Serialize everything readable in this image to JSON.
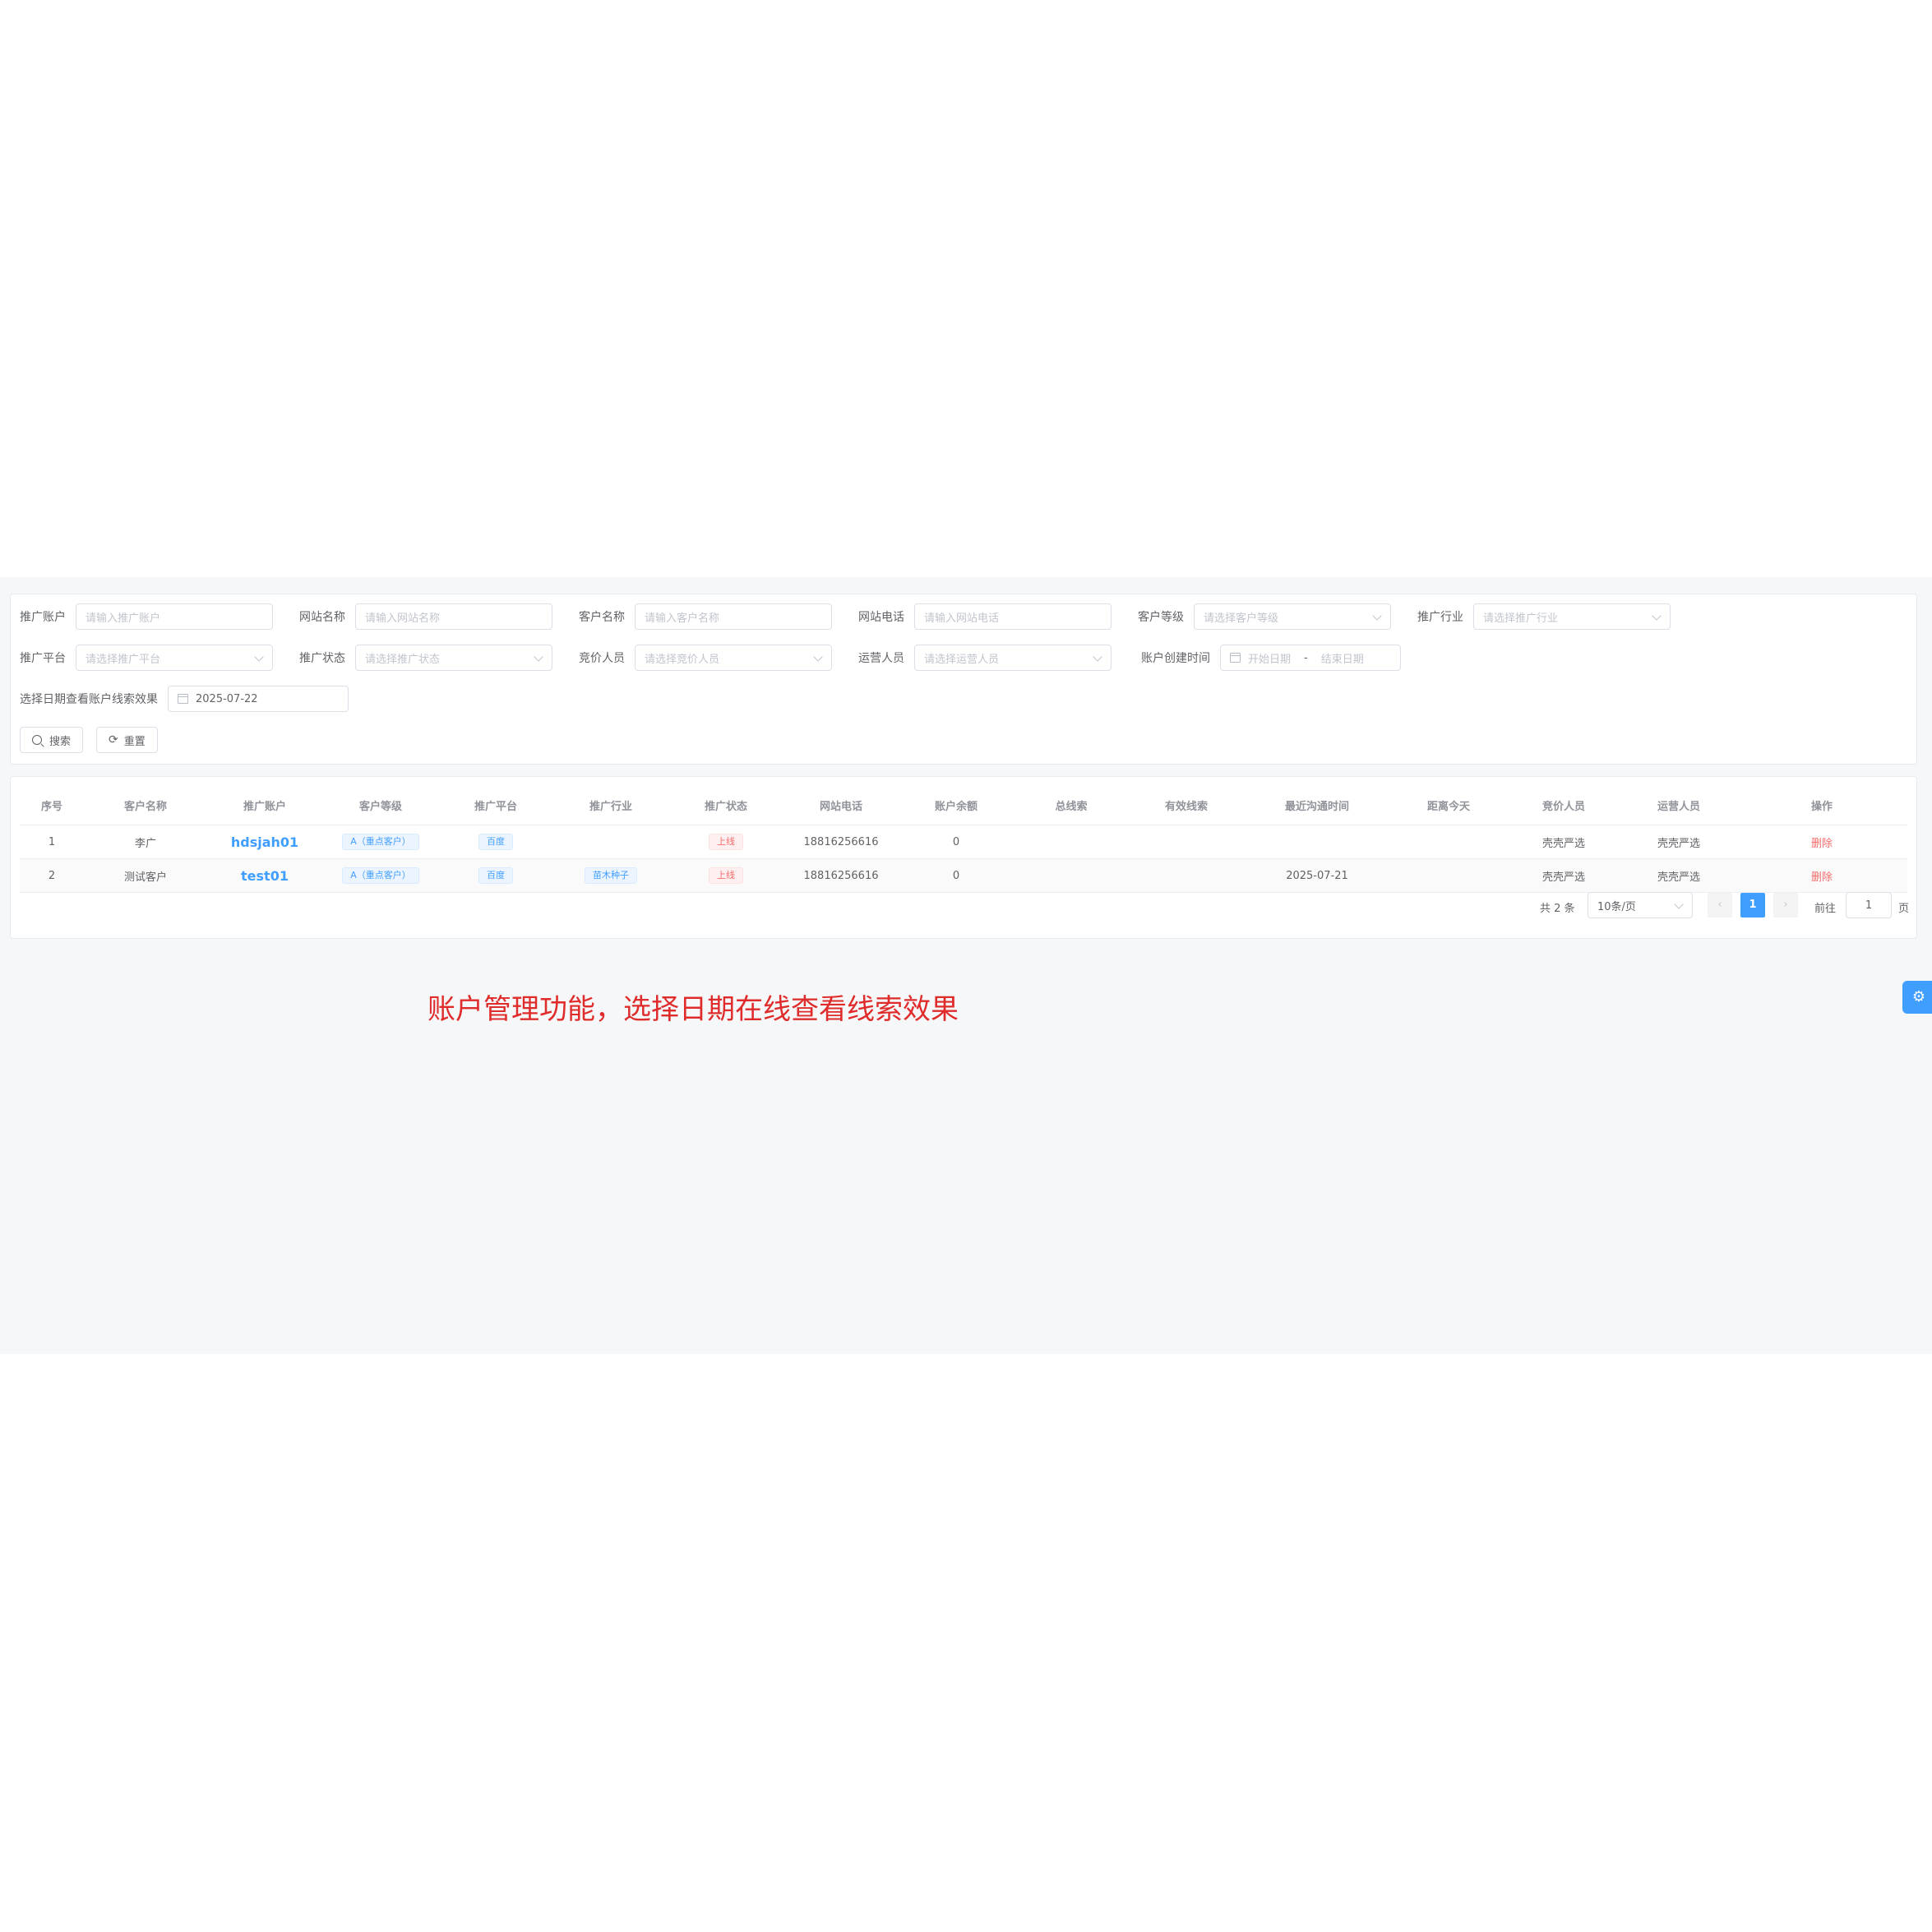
{
  "filters": {
    "row1": [
      {
        "label": "推广账户",
        "placeholder": "请输入推广账户",
        "type": "input"
      },
      {
        "label": "网站名称",
        "placeholder": "请输入网站名称",
        "type": "input"
      },
      {
        "label": "客户名称",
        "placeholder": "请输入客户名称",
        "type": "input"
      },
      {
        "label": "网站电话",
        "placeholder": "请输入网站电话",
        "type": "input"
      },
      {
        "label": "客户等级",
        "placeholder": "请选择客户等级",
        "type": "select"
      },
      {
        "label": "推广行业",
        "placeholder": "请选择推广行业",
        "type": "select"
      }
    ],
    "row2": [
      {
        "label": "推广平台",
        "placeholder": "请选择推广平台",
        "type": "select"
      },
      {
        "label": "推广状态",
        "placeholder": "请选择推广状态",
        "type": "select"
      },
      {
        "label": "竞价人员",
        "placeholder": "请选择竞价人员",
        "type": "select"
      },
      {
        "label": "运营人员",
        "placeholder": "请选择运营人员",
        "type": "select"
      }
    ],
    "created_range": {
      "label": "账户创建时间",
      "start_placeholder": "开始日期",
      "separator": "-",
      "end_placeholder": "结束日期"
    },
    "lead_date": {
      "label": "选择日期查看账户线索效果",
      "value": "2025-07-22"
    },
    "search_label": "搜索",
    "reset_label": "重置"
  },
  "table": {
    "headers": [
      "序号",
      "客户名称",
      "推广账户",
      "客户等级",
      "推广平台",
      "推广行业",
      "推广状态",
      "网站电话",
      "账户余额",
      "总线索",
      "有效线索",
      "最近沟通时间",
      "距离今天",
      "竞价人员",
      "运营人员",
      "操作"
    ],
    "rows": [
      {
        "index": "1",
        "customer": "李广",
        "account": "hdsjah01",
        "level": "A（重点客户）",
        "platform": "百度",
        "industry": "",
        "status": "上线",
        "phone": "18816256616",
        "balance": "0",
        "total_leads": "",
        "valid_leads": "",
        "last_contact": "",
        "days_since": "",
        "bidder": "壳壳严选",
        "operator": "壳壳严选",
        "action": "删除"
      },
      {
        "index": "2",
        "customer": "测试客户",
        "account": "test01",
        "level": "A（重点客户）",
        "platform": "百度",
        "industry": "苗木种子",
        "status": "上线",
        "phone": "18816256616",
        "balance": "0",
        "total_leads": "",
        "valid_leads": "",
        "last_contact": "2025-07-21",
        "days_since": "",
        "bidder": "壳壳严选",
        "operator": "壳壳严选",
        "action": "删除"
      }
    ]
  },
  "pagination": {
    "total": "共 2 条",
    "page_size": "10条/页",
    "prev": "‹",
    "current": "1",
    "next": "›",
    "goto_label": "前往",
    "goto_value": "1",
    "page_unit": "页"
  },
  "caption": "账户管理功能，选择日期在线查看线索效果",
  "icons": {
    "search": "search-icon",
    "reset": "refresh-icon",
    "calendar": "calendar-icon",
    "settings": "gear-icon"
  },
  "colors": {
    "primary": "#409eff",
    "danger": "#f56c6c",
    "caption": "#e02b2b",
    "background": "#f5f7f9"
  }
}
